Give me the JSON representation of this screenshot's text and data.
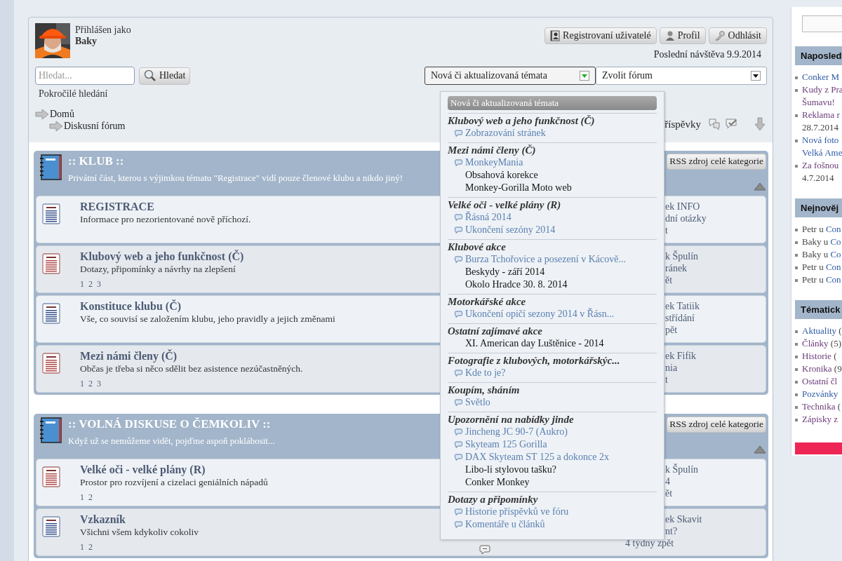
{
  "user": {
    "label": "Přihlášen jako",
    "name": "Baky"
  },
  "header_buttons": [
    {
      "label": "Registrovaní uživatelé"
    },
    {
      "label": "Profil"
    },
    {
      "label": "Odhlásit"
    }
  ],
  "last_visit": "Poslední návštěva 9.9.2014",
  "search": {
    "placeholder": "Hledat...",
    "button": "Hledat",
    "advanced": "Pokročilé hledání"
  },
  "topic_select": {
    "value": "Nová či aktualizovaná témata",
    "expanded": true
  },
  "forum_select": {
    "value": "Zvolit fórum"
  },
  "breadcrumbs": [
    {
      "label": "Domů",
      "children": [
        {
          "label": "Diskusní fórum"
        }
      ]
    }
  ],
  "toolbar": {
    "posts_link": "říspěvky"
  },
  "dropdown": {
    "header": "Nová či aktualizovaná témata",
    "groups": [
      {
        "title": "Klubový web a jeho funkčnost (Č)",
        "topics": [
          {
            "title": "Zobrazování stránek",
            "new": true
          }
        ]
      },
      {
        "title": "Mezi námi členy (Č)",
        "topics": [
          {
            "title": "MonkeyMania",
            "new": true
          },
          {
            "title": "Obsahová korekce",
            "new": false
          },
          {
            "title": "Monkey-Gorilla Moto web",
            "new": false
          }
        ]
      },
      {
        "title": "Velké oči - velké plány (R)",
        "topics": [
          {
            "title": "Řásná 2014",
            "new": true
          },
          {
            "title": "Ukončení sezóny 2014",
            "new": true
          }
        ]
      },
      {
        "title": "Klubové akce",
        "topics": [
          {
            "title": "Burza Tchořovice a posezení v Kácově...",
            "new": true
          },
          {
            "title": "Beskydy - září 2014",
            "new": false
          },
          {
            "title": "Okolo Hradce 30. 8. 2014",
            "new": false
          }
        ]
      },
      {
        "title": "Motorkářské akce",
        "topics": [
          {
            "title": "Ukončení opičí sezony 2014 v Řásn...",
            "new": true
          }
        ]
      },
      {
        "title": "Ostatní zajímavé akce",
        "topics": [
          {
            "title": "XI. American day Luštěnice - 2014",
            "new": false
          }
        ]
      },
      {
        "title": "Fotografie z klubových, motorkářskýc...",
        "topics": [
          {
            "title": "Kde to je?",
            "new": true
          }
        ]
      },
      {
        "title": "Koupím, sháním",
        "topics": [
          {
            "title": "Světlo",
            "new": true
          }
        ]
      },
      {
        "title": "Upozornění na nabídky jinde",
        "topics": [
          {
            "title": "Jincheng JC 90-7 (Aukro)",
            "new": true
          },
          {
            "title": "Skyteam 125 Gorilla",
            "new": true
          },
          {
            "title": "DAX Skyteam ST 125 a dokonce 2x",
            "new": true
          },
          {
            "title": "Libo-li stylovou tašku?",
            "new": false
          },
          {
            "title": "Conker Monkey",
            "new": false
          }
        ]
      },
      {
        "title": "Dotazy a připomínky",
        "topics": [
          {
            "title": "Historie příspěvků ve fóru",
            "new": true
          },
          {
            "title": "Komentáře u článků",
            "new": true
          }
        ]
      }
    ]
  },
  "categories": [
    {
      "title": ":: KLUB ::",
      "description": "Privátní část, kterou s výjimkou tématu \"Registrace\" vidí pouze členové klubu a nikdo jiný!",
      "rss": "RSS zdroj celé kategorie",
      "expanded": true,
      "forums": [
        {
          "title": "REGISTRACE",
          "description": "Informace pro nezorientované nově příchozí.",
          "new_posts": false,
          "reply_icon": false,
          "last_post": [
            {
              "text": "ek INFO",
              "clipped": true
            },
            {
              "text": "dní otázky",
              "clipped": true
            },
            {
              "text": "t",
              "clipped": true
            }
          ]
        },
        {
          "title": "Klubový web a jeho funkčnost (Č)",
          "description": "Dotazy, připomínky a návrhy na zlepšení",
          "pages": [
            "1",
            "2",
            "3"
          ],
          "new_posts": true,
          "reply_icon": false,
          "last_post": [
            {
              "text": "k Špulín",
              "clipped": true
            },
            {
              "text": "ránek",
              "clipped": true
            },
            {
              "text": "ět",
              "clipped": true
            }
          ]
        },
        {
          "title": "Konstituce klubu (Č)",
          "description": "Vše, co souvisí se založením klubu, jeho pravidly a jejich změnami",
          "new_posts": false,
          "reply_icon": false,
          "last_post": [
            {
              "text": "ek Tatiik",
              "clipped": true
            },
            {
              "text": "střídání",
              "clipped": true
            },
            {
              "text": "pět",
              "clipped": true
            }
          ]
        },
        {
          "title": "Mezi námi členy (Č)",
          "description": "Občas je třeba si něco sdělit bez asistence nezúčastněných.",
          "pages": [
            "1",
            "2",
            "3"
          ],
          "new_posts": true,
          "reply_icon": false,
          "last_post": [
            {
              "text": "ek Fifík",
              "clipped": true
            },
            {
              "text": "nia",
              "clipped": true
            },
            {
              "text": "t",
              "clipped": true
            }
          ]
        }
      ]
    },
    {
      "title": ":: VOLNÁ DISKUSE O ČEMKOLIV ::",
      "description": "Když už se nemůžeme vidět, pojďme aspoň poklábosit...",
      "rss": "RSS zdroj celé kategorie",
      "expanded": true,
      "forums": [
        {
          "title": "Velké oči - velké plány (R)",
          "description": "Prostor pro rozvíjení a cizelaci geniálních nápadů",
          "pages": [
            "1",
            "2"
          ],
          "new_posts": true,
          "reply_icon": false,
          "last_post": [
            {
              "text": "k Špulín",
              "clipped": true
            },
            {
              "text": "4",
              "clipped": true
            },
            {
              "text": "ět",
              "clipped": true
            }
          ]
        },
        {
          "title": "Vzkazník",
          "description": "Všichni všem kdykoliv cokoliv",
          "pages": [
            "1",
            "2"
          ],
          "new_posts": false,
          "reply_icon": true,
          "last_post": [
            {
              "text": "ek Skavit",
              "clipped": true
            },
            {
              "text": "nt?",
              "clipped": true
            },
            {
              "text": "4 týdny zpět",
              "clipped": false
            }
          ]
        }
      ]
    }
  ],
  "sidebar": {
    "sections": [
      {
        "title": "Naposled",
        "kind": "articles",
        "items": [
          {
            "lines": [
              "Conker M"
            ],
            "visited": false
          },
          {
            "lines": [
              "Kudy z Pra",
              "Šumavu!"
            ],
            "visited": true
          },
          {
            "lines": [
              "Reklama r"
            ],
            "visited": true,
            "date": "28.7.2014"
          },
          {
            "lines": [
              "Nová foto",
              "Velká Ame"
            ],
            "visited": false
          },
          {
            "lines": [
              "Za fošnou"
            ],
            "visited": true,
            "date": "4.7.2014"
          }
        ]
      },
      {
        "title": "Nejnověj",
        "kind": "comments",
        "items": [
          {
            "author": "Petr u",
            "link": "Con"
          },
          {
            "author": "Baky u",
            "link": "Co"
          },
          {
            "author": "Baky u",
            "link": "Co"
          },
          {
            "author": "Petr u",
            "link": "Con"
          },
          {
            "author": "Petr u",
            "link": "Con"
          }
        ]
      },
      {
        "title": "Tématick",
        "kind": "topics",
        "items": [
          {
            "link": "Aktuality",
            "count": "(",
            "visited": false
          },
          {
            "link": "Články",
            "count": "(5)",
            "visited": true
          },
          {
            "link": "Historie",
            "count": "(",
            "visited": true
          },
          {
            "link": "Kronika",
            "count": "(9",
            "visited": true
          },
          {
            "link": "Ostatní čl",
            "visited": true
          },
          {
            "link": "Pozvánky",
            "visited": false
          },
          {
            "link": "Technika",
            "count": "(",
            "visited": true
          },
          {
            "link": "Zápisky z",
            "visited": true
          }
        ]
      }
    ]
  }
}
